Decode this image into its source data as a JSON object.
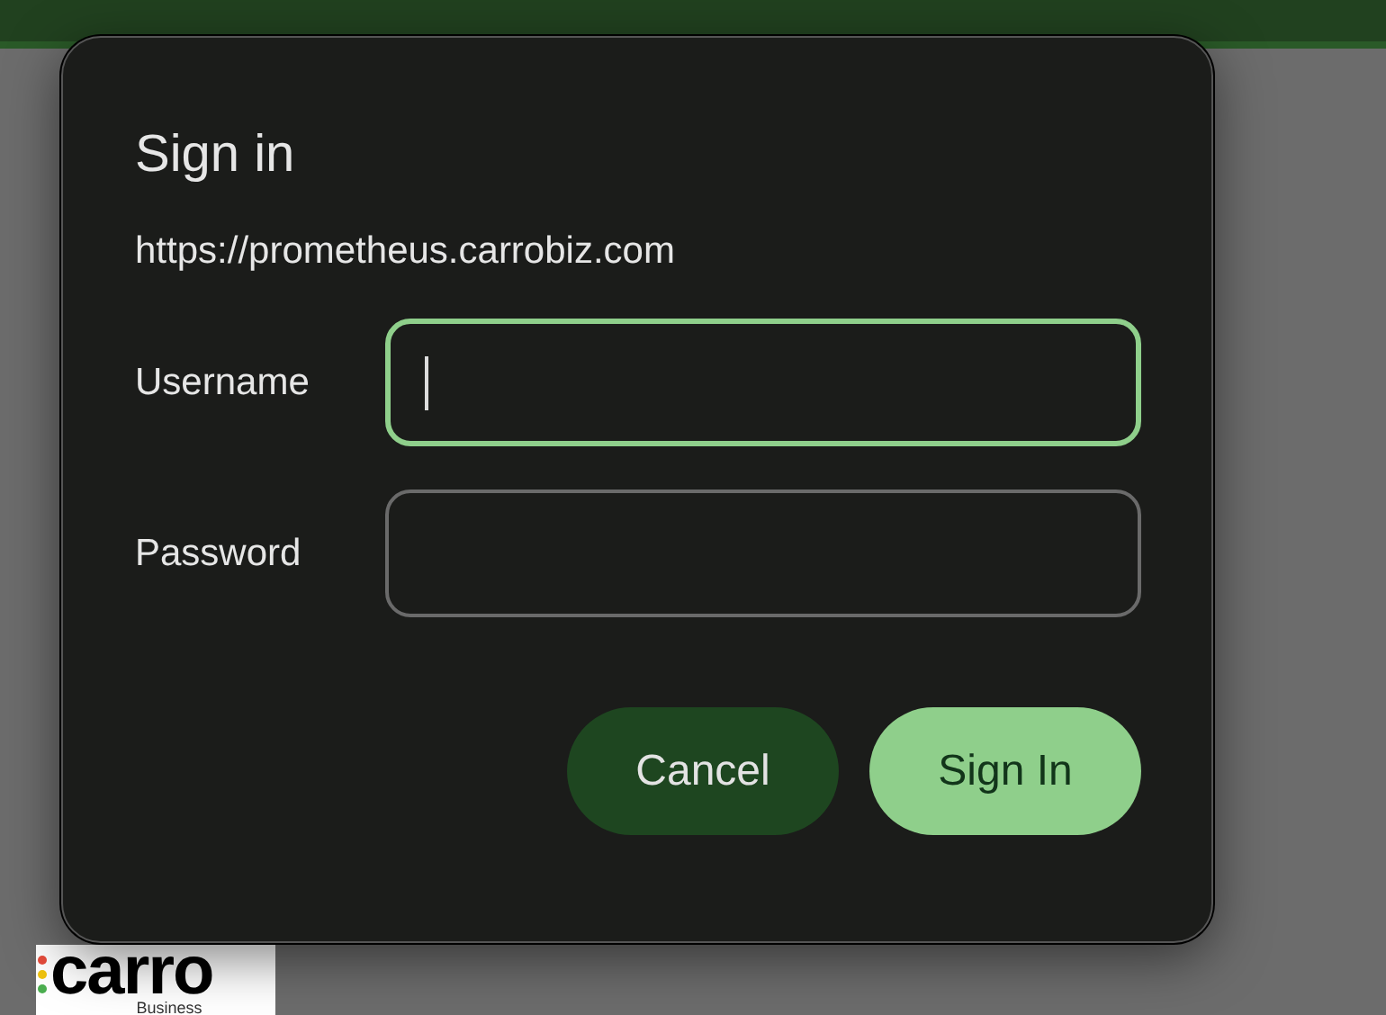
{
  "dialog": {
    "title": "Sign in",
    "origin": "https://prometheus.carrobiz.com",
    "fields": [
      {
        "label": "Username",
        "focused": true
      },
      {
        "label": "Password",
        "focused": false
      }
    ],
    "buttons": [
      {
        "label": "Cancel",
        "kind": "secondary"
      },
      {
        "label": "Sign In",
        "kind": "primary"
      }
    ]
  },
  "logo": {
    "wordmark": "carro",
    "tagline": "Business"
  }
}
